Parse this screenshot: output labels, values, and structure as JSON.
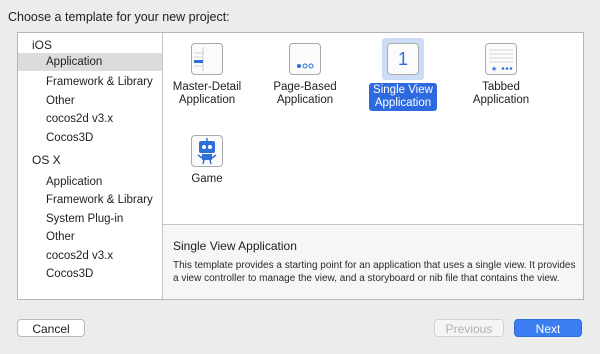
{
  "dialog": {
    "title": "Choose a template for your new project:"
  },
  "sidebar": {
    "groups": [
      {
        "header": "iOS",
        "items": [
          "Application",
          "Framework & Library",
          "Other",
          "cocos2d v3.x",
          "Cocos3D"
        ]
      },
      {
        "header": "OS X",
        "items": [
          "Application",
          "Framework & Library",
          "System Plug-in",
          "Other",
          "cocos2d v3.x",
          "Cocos3D"
        ]
      }
    ],
    "selected": "iOS / Application"
  },
  "templates": [
    {
      "line1": "Master-Detail",
      "line2": "Application",
      "icon": "master-detail-icon"
    },
    {
      "line1": "Page-Based",
      "line2": "Application",
      "icon": "page-based-icon"
    },
    {
      "line1": "Single View",
      "line2": "Application",
      "icon": "single-view-icon",
      "icon_text": "1",
      "selected": true
    },
    {
      "line1": "Tabbed",
      "line2": "Application",
      "icon": "tabbed-icon"
    },
    {
      "line1": "Game",
      "line2": "",
      "icon": "game-icon"
    }
  ],
  "description": {
    "title": "Single View Application",
    "body": "This template provides a starting point for an application that uses a single view. It provides a view controller to manage the view, and a storyboard or nib file that contains the view."
  },
  "buttons": {
    "cancel": "Cancel",
    "previous": "Previous",
    "next": "Next"
  },
  "colors": {
    "accent": "#3a7ef2",
    "selection": "#2d6ae0",
    "icon_blue": "#2f6fd8"
  }
}
